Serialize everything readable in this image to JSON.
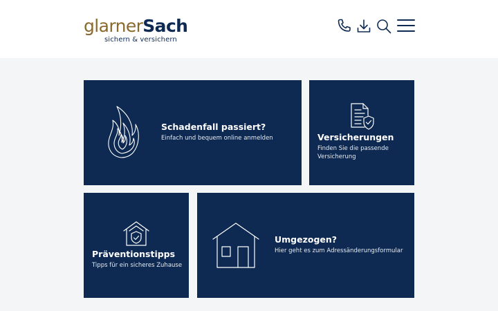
{
  "header": {
    "logo_part1": "glarner",
    "logo_part2": "Sach",
    "tagline": "sichern & versichern",
    "icons": [
      "phone-icon",
      "download-icon",
      "search-icon",
      "menu-icon"
    ]
  },
  "colors": {
    "navy": "#0e2a52",
    "gold": "#8a6a2c",
    "background": "#f4f5f7"
  },
  "cards": [
    {
      "title": "Schadenfall passiert?",
      "text": "Einfach und bequem online anmelden",
      "icon": "flame-icon"
    },
    {
      "title": "Versicherungen",
      "text": "Finden Sie die passende Versicherung",
      "icon": "insurance-document-icon"
    },
    {
      "title": "Präventionstipps",
      "text": "Tipps für ein sicheres Zuhause",
      "icon": "house-shield-icon"
    },
    {
      "title": "Umgezogen?",
      "text": "Hier geht es zum Adressänderungsformular",
      "icon": "house-icon"
    }
  ]
}
